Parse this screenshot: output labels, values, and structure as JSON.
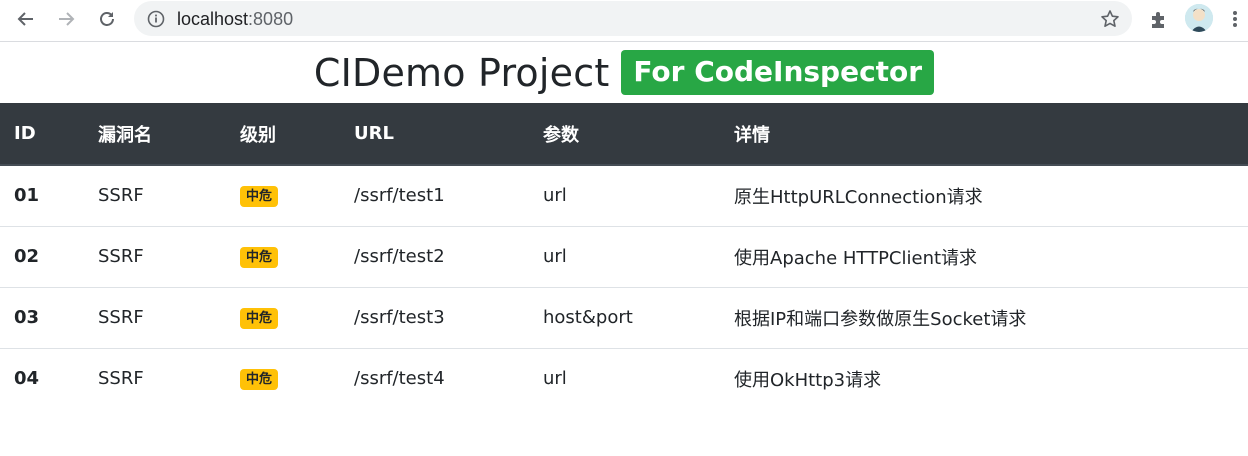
{
  "browser": {
    "url_host": "localhost",
    "url_port": ":8080",
    "icons": [
      "back-arrow-icon",
      "forward-arrow-icon",
      "reload-icon",
      "info-icon",
      "star-icon",
      "puzzle-icon",
      "avatar",
      "kebab-menu-icon"
    ]
  },
  "page": {
    "title": "CIDemo Project",
    "badge": "For CodeInspector"
  },
  "colors": {
    "header_bg": "#343a40",
    "title_badge": "#28a745",
    "level_badge": "#ffc107"
  },
  "table": {
    "headers": [
      "ID",
      "漏洞名",
      "级别",
      "URL",
      "参数",
      "详情"
    ],
    "rows": [
      {
        "id": "01",
        "name": "SSRF",
        "level": "中危",
        "url": "/ssrf/test1",
        "param": "url",
        "detail": "原生HttpURLConnection请求"
      },
      {
        "id": "02",
        "name": "SSRF",
        "level": "中危",
        "url": "/ssrf/test2",
        "param": "url",
        "detail": "使用Apache HTTPClient请求"
      },
      {
        "id": "03",
        "name": "SSRF",
        "level": "中危",
        "url": "/ssrf/test3",
        "param": "host&port",
        "detail": "根据IP和端口参数做原生Socket请求"
      },
      {
        "id": "04",
        "name": "SSRF",
        "level": "中危",
        "url": "/ssrf/test4",
        "param": "url",
        "detail": "使用OkHttp3请求"
      }
    ]
  }
}
